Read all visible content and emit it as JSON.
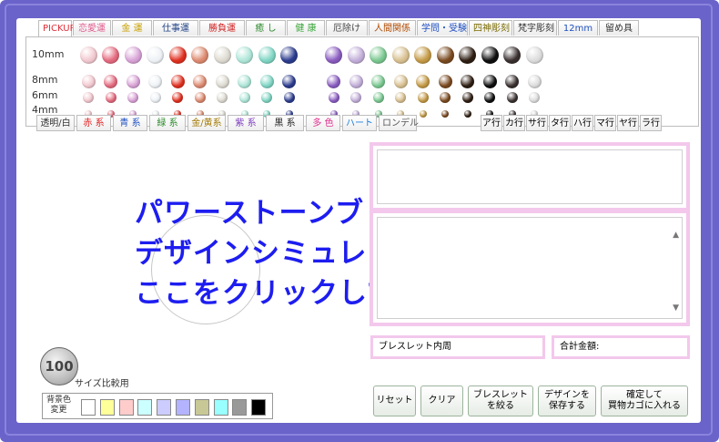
{
  "tabs": [
    {
      "label": "PICKUP",
      "color": "#e0303a"
    },
    {
      "label": "恋愛運",
      "color": "#e05b8c"
    },
    {
      "label": "金 運",
      "color": "#c8a000"
    },
    {
      "label": "仕事運",
      "color": "#224488"
    },
    {
      "label": "勝負運",
      "color": "#d02020"
    },
    {
      "label": "癒 し",
      "color": "#2a8a2a"
    },
    {
      "label": "健 康",
      "color": "#3aa63a"
    },
    {
      "label": "厄除け",
      "color": "#444444"
    },
    {
      "label": "人間関係",
      "color": "#b04a00"
    },
    {
      "label": "学問・受験",
      "color": "#2050c0"
    },
    {
      "label": "四神彫刻",
      "color": "#7a6a00"
    },
    {
      "label": "梵字彫刻",
      "color": "#333333"
    },
    {
      "label": "12mm",
      "color": "#2050c0"
    },
    {
      "label": "留め具",
      "color": "#333333"
    }
  ],
  "sizes": [
    "10mm",
    "8mm",
    "6mm",
    "4mm"
  ],
  "beads": {
    "colors": [
      "#f2c8cf",
      "#e46a7e",
      "#d8a2d6",
      "#eef2f6",
      "#e03020",
      "#dd8a70",
      "#dcdad0",
      "#aee6d8",
      "#7fd6c4",
      "#2c3c8e",
      "#f4f4f4",
      "#8a5cc0",
      "#c2aed9",
      "#7ac890",
      "#d8c090",
      "#c49a46",
      "#7a4a20",
      "#2e1e12",
      "#0e0e0e",
      "#3a3030",
      "#dcdcdc"
    ]
  },
  "filters": [
    {
      "label": "透明/白",
      "color": "#333333"
    },
    {
      "label": "赤 系",
      "color": "#e02020"
    },
    {
      "label": "青 系",
      "color": "#2050c0"
    },
    {
      "label": "緑 系",
      "color": "#2a8a2a"
    },
    {
      "label": "金/黄系",
      "color": "#a07800"
    },
    {
      "label": "紫 系",
      "color": "#8040c0"
    },
    {
      "label": "黒 系",
      "color": "#222222"
    },
    {
      "label": "多 色",
      "color": "#e03090"
    },
    {
      "label": "ハート",
      "color": "#2080e0"
    },
    {
      "label": "ロンデル",
      "color": "#555555"
    }
  ],
  "kana": [
    "ア行",
    "カ行",
    "サ行",
    "タ行",
    "ハ行",
    "マ行",
    "ヤ行",
    "ラ行"
  ],
  "headline": {
    "line1": "パワーストーンブレスレット",
    "line2": "デザインシミュレーターへは、",
    "line3": "ここをクリックして下さい。"
  },
  "info": {
    "inner": "ブレスレット内周",
    "total": "合計金額:"
  },
  "actions": [
    {
      "label": "リセット"
    },
    {
      "label": "クリア"
    },
    {
      "label": "ブレスレット\nを絞る"
    },
    {
      "label": "デザインを\n保存する"
    },
    {
      "label": "確定して\n買物カゴに入れる"
    }
  ],
  "coin": {
    "value": "100",
    "caption": "サイズ比較用"
  },
  "background": {
    "label": "背景色\n変更",
    "swatches": [
      "#ffffff",
      "#ffff99",
      "#ffcccc",
      "#ccffff",
      "#ccccff",
      "#b3b3ff",
      "#c8c896",
      "#99ffff",
      "#999999",
      "#000000"
    ]
  }
}
